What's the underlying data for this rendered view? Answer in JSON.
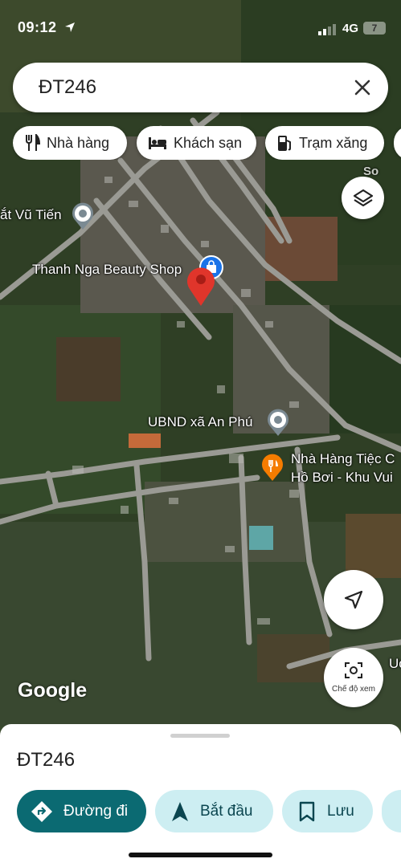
{
  "status_bar": {
    "time": "09:12",
    "network": "4G",
    "battery": "7"
  },
  "search": {
    "query": "ĐT246"
  },
  "chips": [
    {
      "label": "Nhà hàng",
      "icon": "fork-knife-icon"
    },
    {
      "label": "Khách sạn",
      "icon": "bed-icon"
    },
    {
      "label": "Trạm xăng",
      "icon": "gas-station-icon"
    }
  ],
  "map_labels": {
    "vu_tien": "ắt Vũ Tiến",
    "beauty_shop": "Thanh Nga Beauty Shop",
    "ubnd": "UBND xã An Phú",
    "restaurant_line1": "Nhà Hàng Tiệc C",
    "restaurant_line2": "Hồ Bơi - Khu Vui",
    "edge_right": "Uc",
    "watermark": "So"
  },
  "map_controls": {
    "view_mode_label": "Chế độ xem"
  },
  "attribution": "Google",
  "place_sheet": {
    "title": "ĐT246",
    "actions": [
      {
        "label": "Đường đi",
        "icon": "directions-icon"
      },
      {
        "label": "Bắt đầu",
        "icon": "navigation-arrow-icon"
      },
      {
        "label": "Lưu",
        "icon": "bookmark-icon"
      }
    ]
  },
  "colors": {
    "accent": "#0b6a72",
    "accent_light": "#cdeef2",
    "pin_red": "#e0352b",
    "poi_orange": "#f57c00",
    "poi_blue": "#1a73e8"
  }
}
